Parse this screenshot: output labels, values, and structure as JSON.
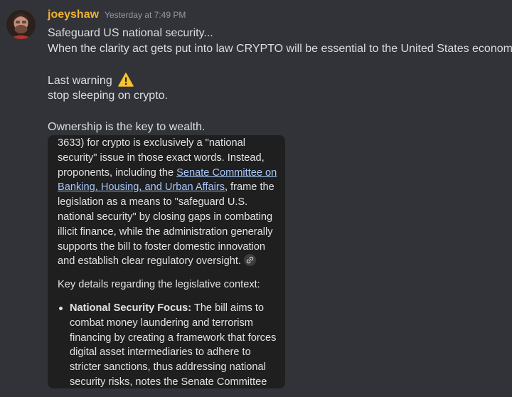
{
  "message": {
    "username": "joeyshaw",
    "timestamp": "Yesterday at 7:49 PM",
    "avatar": "user-avatar",
    "lines": {
      "l1": "Safeguard US national security...",
      "l2": "When the clarity act gets put into law CRYPTO will be essential to the United States economy!",
      "l3": "Last warning",
      "l4": "stop sleeping on crypto.",
      "l5": "Ownership is the key to wealth."
    },
    "warning_icon": "warning-icon"
  },
  "embed": {
    "para1_a": "3633) for crypto is exclusively a \"national security\" issue in those exact words. Instead, proponents, including the ",
    "para1_link": "Senate Committee on Banking, Housing, and Urban Affairs",
    "para1_b": ", frame the legislation as a means to \"safeguard U.S. national security\" by closing gaps in combating illicit finance, while the administration generally supports the bill to foster domestic innovation and establish clear regulatory oversight.",
    "link_chip_icon": "link-icon",
    "para2": "Key details regarding the legislative context:",
    "bullet1_bold": "National Security Focus:",
    "bullet1_text": " The bill aims to combat money laundering and terrorism financing by creating a framework that forces digital asset intermediaries to adhere to stricter sanctions, thus addressing national security risks, notes the Senate Committee on"
  },
  "colors": {
    "background": "#313338",
    "username": "#f0b232",
    "timestamp": "#949ba4",
    "text": "#dbdee1",
    "embed_bg": "#1f1f1f",
    "link": "#a8c7fa"
  }
}
